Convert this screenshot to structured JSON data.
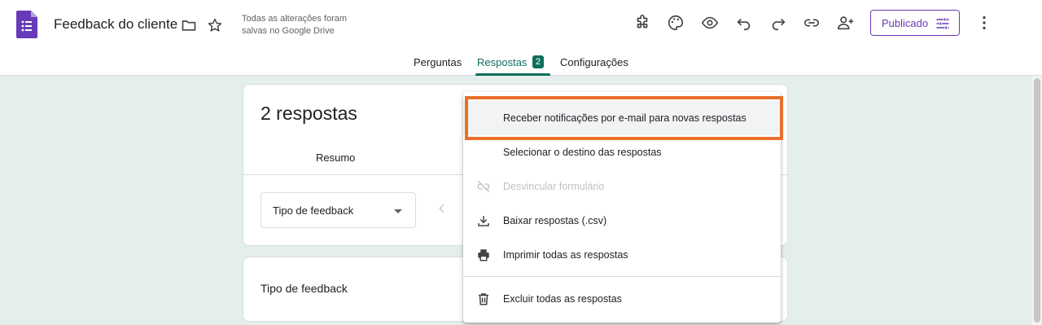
{
  "header": {
    "title": "Feedback do cliente",
    "save_status_line1": "Todas as alterações foram",
    "save_status_line2": "salvas no Google Drive",
    "publish_label": "Publicado",
    "icons": [
      "puzzle-icon",
      "palette-icon",
      "eye-icon",
      "undo-icon",
      "redo-icon",
      "link-icon",
      "add-person-icon",
      "more-vert-icon"
    ]
  },
  "tabs": [
    {
      "label": "Perguntas",
      "active": false
    },
    {
      "label": "Respostas",
      "active": true,
      "badge": "2"
    },
    {
      "label": "Configurações",
      "active": false
    }
  ],
  "responses_card": {
    "count_label": "2 respostas",
    "sub_tab": "Resumo",
    "select_value": "Tipo de feedback"
  },
  "question_card": {
    "title": "Tipo de feedback"
  },
  "menu": {
    "items": [
      {
        "label": "Receber notificações por e-mail para novas respostas",
        "icon": "none",
        "disabled": false
      },
      {
        "label": "Selecionar o destino das respostas",
        "icon": "none",
        "disabled": false
      },
      {
        "label": "Desvincular formulário",
        "icon": "link-off-icon",
        "disabled": true
      },
      {
        "label": "Baixar respostas (.csv)",
        "icon": "download-icon",
        "disabled": false
      },
      {
        "label": "Imprimir todas as respostas",
        "icon": "print-icon",
        "disabled": false
      },
      {
        "label": "Excluir todas as respostas",
        "icon": "trash-icon",
        "disabled": false
      }
    ]
  },
  "colors": {
    "accent": "#0f6e5e",
    "brand": "#673ab7",
    "highlight": "#e8702a",
    "background": "#e4efed"
  }
}
